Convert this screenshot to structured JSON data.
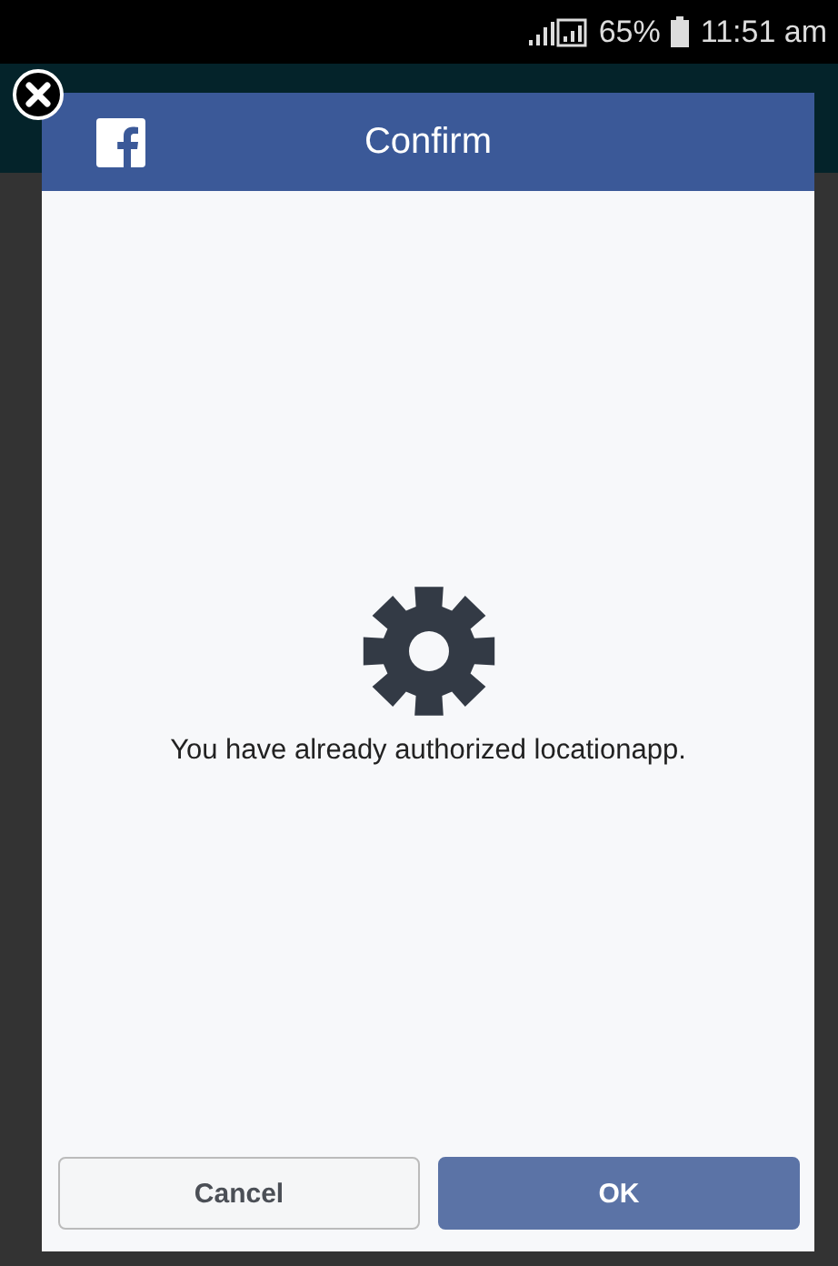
{
  "status_bar": {
    "battery": "65%",
    "time": "11:51 am"
  },
  "dialog": {
    "title": "Confirm",
    "message": "You have already authorized locationapp.",
    "buttons": [
      {
        "label": "Cancel",
        "kind": "secondary"
      },
      {
        "label": "OK",
        "kind": "primary"
      }
    ]
  }
}
